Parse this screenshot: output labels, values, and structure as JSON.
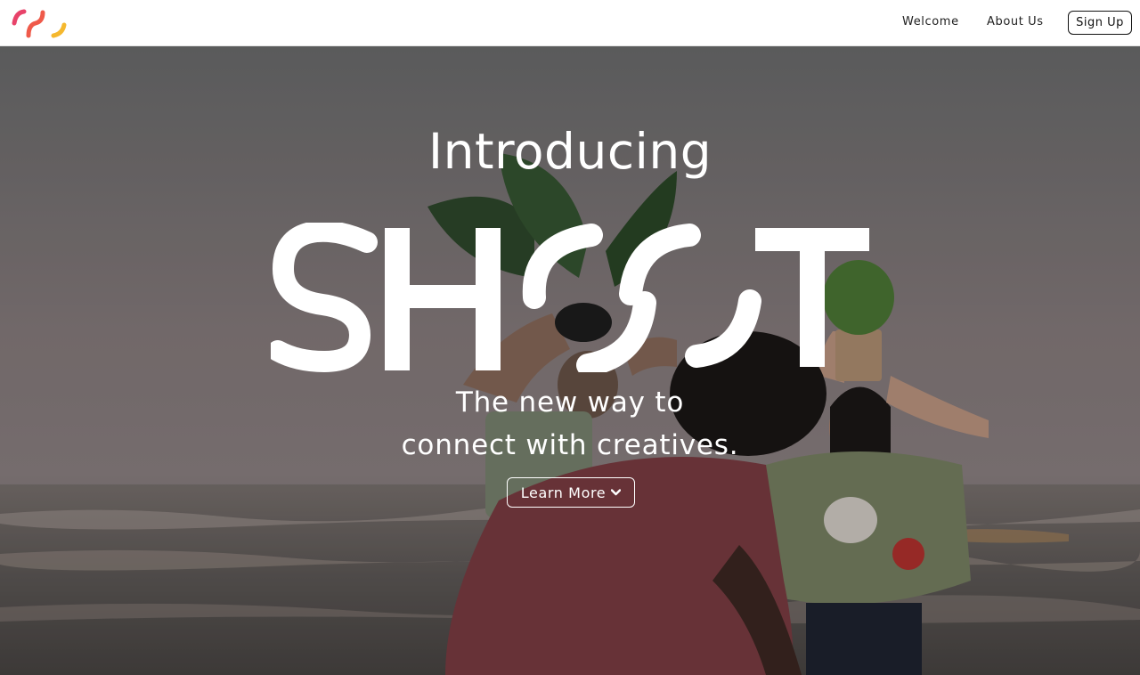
{
  "nav": {
    "logo_alt": "Shoot logo",
    "links": [
      "Welcome",
      "About Us"
    ],
    "signup_label": "Sign Up"
  },
  "hero": {
    "intro": "Introducing",
    "wordmark_text": "SHOOT",
    "tagline_line1": "The new way to",
    "tagline_line2": "connect with creatives.",
    "cta_label": "Learn More",
    "cta_icon": "chevron-down-icon",
    "background_scene": "photo"
  },
  "colors": {
    "logo_pink": "#e8436a",
    "logo_orange": "#ef7b3b",
    "logo_yellow": "#f5b82e",
    "overlay": "rgba(0,0,0,0.18)",
    "text_light": "#ffffff"
  }
}
